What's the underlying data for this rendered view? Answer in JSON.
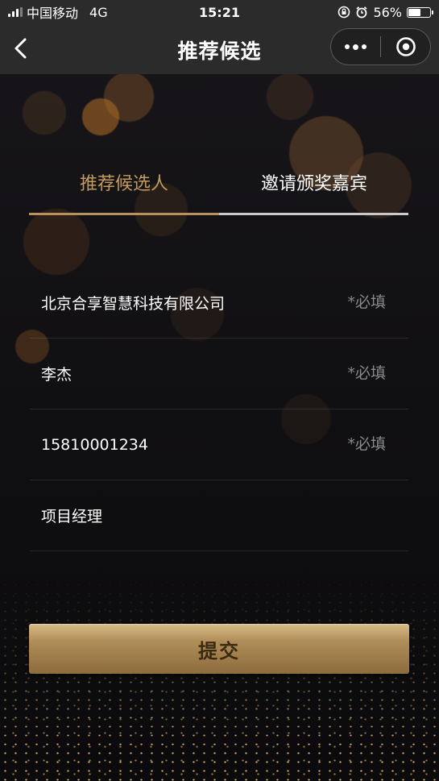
{
  "status_bar": {
    "carrier": "中国移动",
    "network": "4G",
    "time": "15:21",
    "battery": "56%",
    "battery_level": 0.56
  },
  "nav": {
    "title": "推荐候选"
  },
  "tabs": [
    {
      "label": "推荐候选人",
      "active": true
    },
    {
      "label": "邀请颁奖嘉宾",
      "active": false
    }
  ],
  "form": {
    "fields": [
      {
        "value": "北京合享智慧科技有限公司",
        "required_hint": "*必填"
      },
      {
        "value": "李杰",
        "required_hint": "*必填"
      },
      {
        "value": "15810001234",
        "required_hint": "*必填"
      },
      {
        "value": "项目经理",
        "required_hint": ""
      }
    ]
  },
  "submit_label": "提交",
  "colors": {
    "accent_gold": "#c39a5e",
    "background": "#0d0d0f",
    "bar": "#2b2b2b"
  }
}
